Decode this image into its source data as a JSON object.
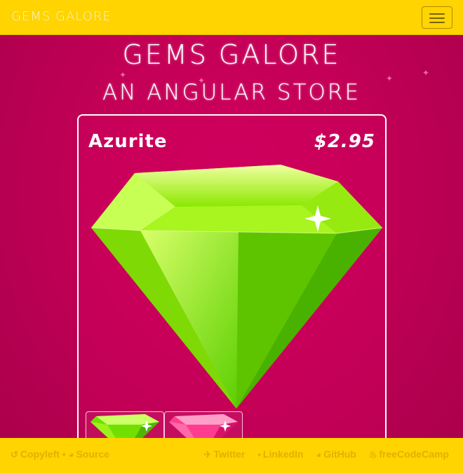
{
  "navbar": {
    "brand": "GEMS GALORE",
    "toggle_label": "Toggle navigation"
  },
  "hero": {
    "title": "GEMS GALORE",
    "subtitle": "AN ANGULAR STORE"
  },
  "product": {
    "name": "Azurite",
    "price": "$2.95",
    "thumbnails": [
      "green-gem",
      "pink-gem"
    ]
  },
  "footer": {
    "copyleft": "Copyleft",
    "separator": "•",
    "source": "Source",
    "links": {
      "twitter": "Twitter",
      "linkedin": "LinkedIn",
      "github": "GitHub",
      "freecodecamp": "freeCodeCamp"
    }
  },
  "colors": {
    "navbar": "#ffd400",
    "background": "#c20056",
    "link": "#e0b100",
    "gem_green": "#6ee000",
    "gem_pink": "#ff3d8f"
  }
}
